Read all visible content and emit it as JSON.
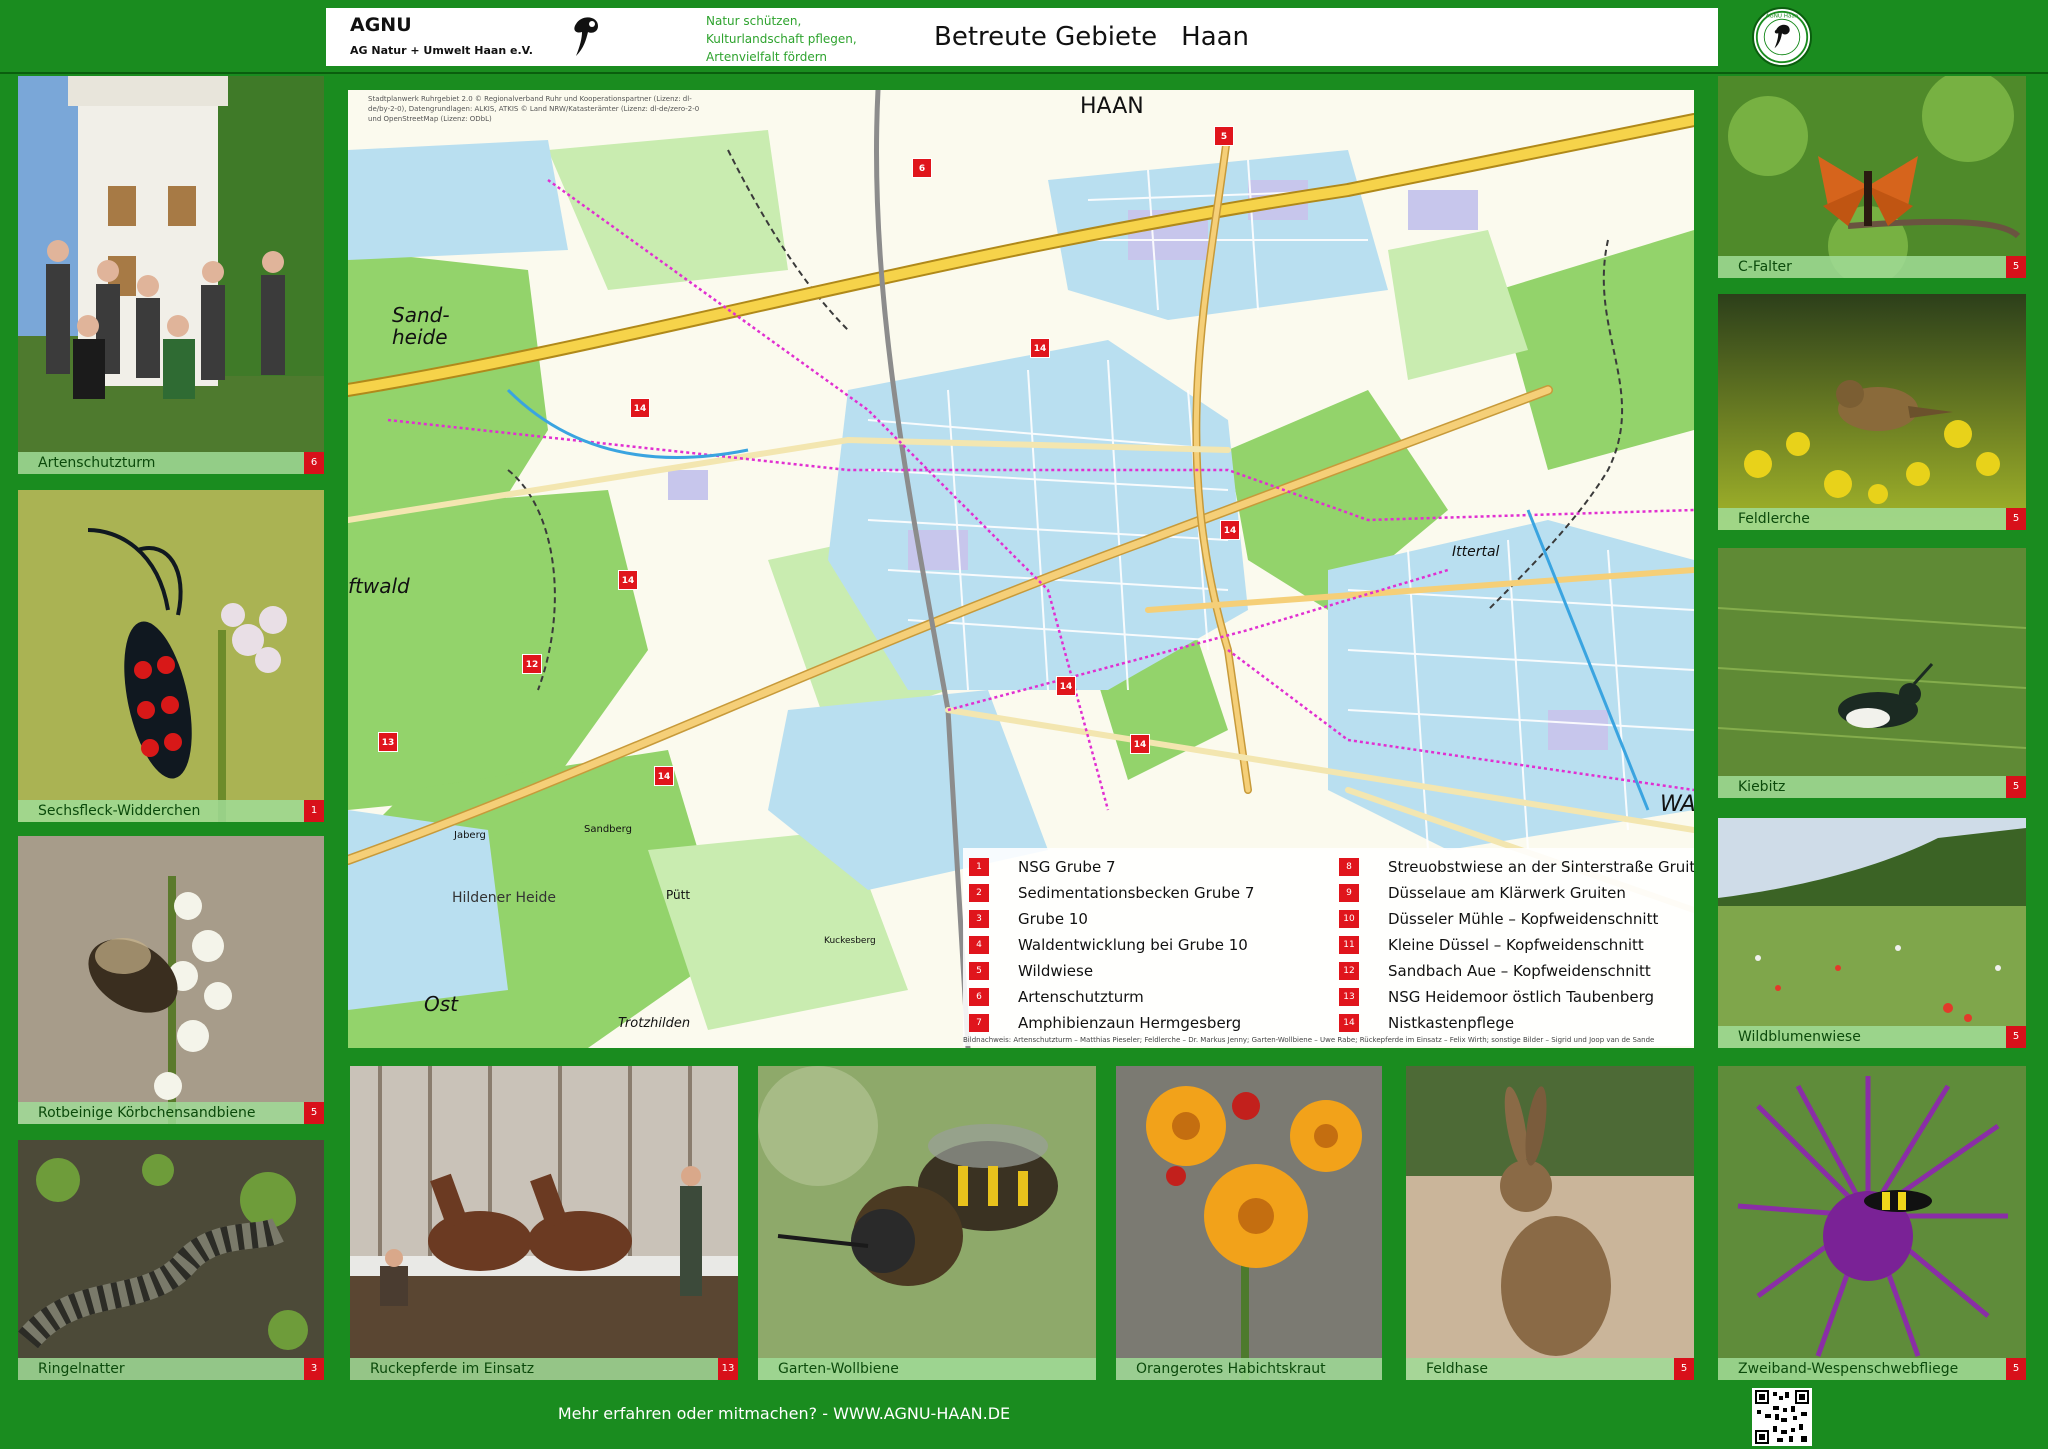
{
  "header": {
    "org_name": "AGNU",
    "org_sub": "AG Natur + Umwelt Haan e.V.",
    "slogan": [
      "Natur schützen,",
      "Kulturlandschaft pflegen,",
      "Artenvielfalt fördern"
    ],
    "title_a": "Betreute Gebiete",
    "title_b": "Haan",
    "badge_text": "AGNU Haan"
  },
  "left_tiles": [
    {
      "label": "Artenschutzturm",
      "num": "6"
    },
    {
      "label": "Sechsfleck-Widderchen",
      "num": "1"
    },
    {
      "label": "Rotbeinige Körbchensandbiene",
      "num": "5"
    },
    {
      "label": "Ringelnatter",
      "num": "3"
    }
  ],
  "right_tiles": [
    {
      "label": "C-Falter",
      "num": "5"
    },
    {
      "label": "Feldlerche",
      "num": "5"
    },
    {
      "label": "Kiebitz",
      "num": "5"
    },
    {
      "label": "Wildblumenwiese",
      "num": "5"
    },
    {
      "label": "Zweiband-Wespenschwebfliege",
      "num": "5"
    }
  ],
  "bottom_tiles": [
    {
      "label": "Ruckepferde im Einsatz",
      "num": "13"
    },
    {
      "label": "Garten-Wollbiene",
      "num": ""
    },
    {
      "label": "Orangerotes Habichtskraut",
      "num": ""
    },
    {
      "label": "Feldhase",
      "num": "5"
    }
  ],
  "map": {
    "credit": "Stadtplanwerk Ruhrgebiet 2.0 © Regionalverband Ruhr und Kooperationspartner (Lizenz: dl-de/by-2-0), Datengrundlagen: ALKIS, ATKIS © Land NRW/Katasterämter (Lizenz: dl-de/zero-2-0 und OpenStreetMap (Lizenz: ODbL)",
    "labels": {
      "haan": "HAAN",
      "sandheide": "Sand-\nheide",
      "waldwald": "ftwald",
      "hildener_heide": "Hildener Heide",
      "ost": "Ost",
      "wa": "WA",
      "trotzhilden": "Trotzhilden",
      "pütt": "Pütt",
      "jaberg": "Jaberg",
      "sandberg": "Sandberg",
      "ittertal": "Ittertal",
      "kuckesberg": "Kuckesberg"
    },
    "markers": [
      {
        "num": "5"
      },
      {
        "num": "6"
      },
      {
        "num": "14"
      },
      {
        "num": "14"
      },
      {
        "num": "14"
      },
      {
        "num": "14"
      },
      {
        "num": "12"
      },
      {
        "num": "13"
      },
      {
        "num": "14"
      },
      {
        "num": "14"
      },
      {
        "num": "14"
      }
    ]
  },
  "legend": [
    {
      "num": "1",
      "label": "NSG Grube 7"
    },
    {
      "num": "2",
      "label": "Sedimentationsbecken Grube 7"
    },
    {
      "num": "3",
      "label": "Grube 10"
    },
    {
      "num": "4",
      "label": "Waldentwicklung bei Grube 10"
    },
    {
      "num": "5",
      "label": "Wildwiese"
    },
    {
      "num": "6",
      "label": "Artenschutzturm"
    },
    {
      "num": "7",
      "label": "Amphibienzaun Hermgesberg"
    },
    {
      "num": "8",
      "label": "Streuobstwiese an der Sinterstraße Gruiten"
    },
    {
      "num": "9",
      "label": "Düsselaue am Klärwerk Gruiten"
    },
    {
      "num": "10",
      "label": "Düsseler Mühle – Kopfweidenschnitt"
    },
    {
      "num": "11",
      "label": "Kleine Düssel – Kopfweidenschnitt"
    },
    {
      "num": "12",
      "label": "Sandbach Aue – Kopfweidenschnitt"
    },
    {
      "num": "13",
      "label": "NSG Heidemoor östlich Taubenberg"
    },
    {
      "num": "14",
      "label": "Nistkastenpflege"
    }
  ],
  "photo_credit": "Bildnachweis: Artenschutzturm – Matthias Pieseler; Feldlerche – Dr. Markus Jenny; Garten-Wollbiene – Uwe Rabe; Rückepferde im Einsatz – Felix Wirth; sonstige Bilder – Sigrid und Joop van de Sande",
  "footer": {
    "text": "Mehr erfahren oder mitmachen?   -   WWW.AGNU-HAAN.DE"
  }
}
